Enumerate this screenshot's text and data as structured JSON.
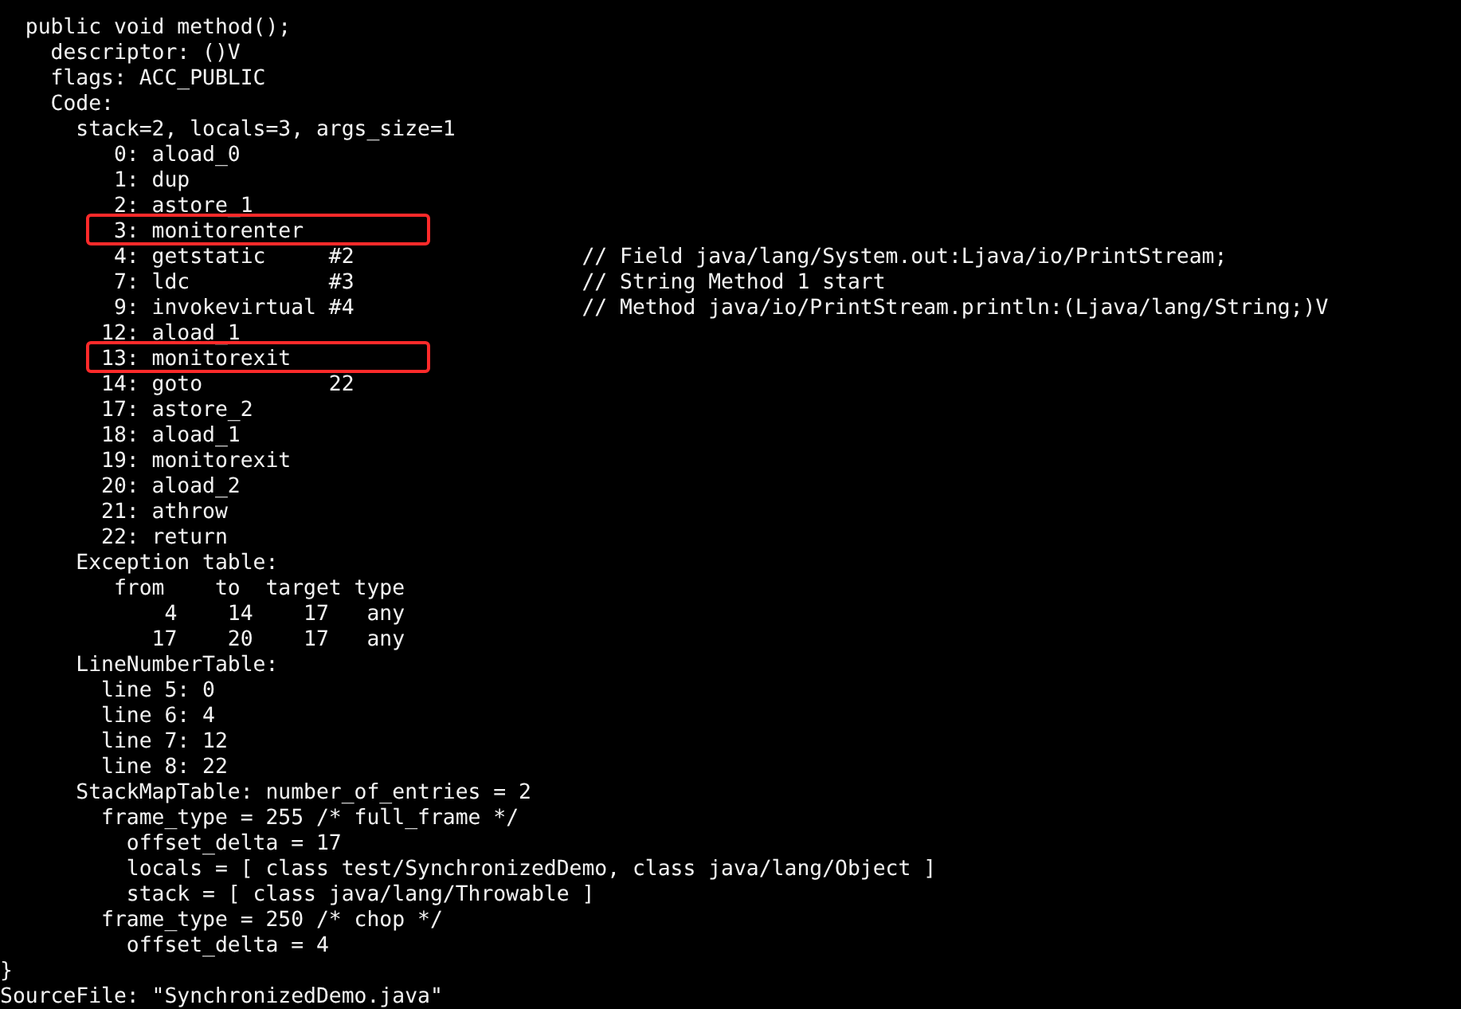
{
  "console": {
    "lines": [
      {
        "text": "  public void method();",
        "highlighted": false
      },
      {
        "text": "    descriptor: ()V",
        "highlighted": false
      },
      {
        "text": "    flags: ACC_PUBLIC",
        "highlighted": false
      },
      {
        "text": "    Code:",
        "highlighted": false
      },
      {
        "text": "      stack=2, locals=3, args_size=1",
        "highlighted": false
      },
      {
        "text": "         0: aload_0",
        "highlighted": false
      },
      {
        "text": "         1: dup",
        "highlighted": false
      },
      {
        "text": "         2: astore_1",
        "highlighted": false
      },
      {
        "text": "         3: monitorenter",
        "highlighted": true
      },
      {
        "text": "         4: getstatic     #2                  // Field java/lang/System.out:Ljava/io/PrintStream;",
        "highlighted": false
      },
      {
        "text": "         7: ldc           #3                  // String Method 1 start",
        "highlighted": false
      },
      {
        "text": "         9: invokevirtual #4                  // Method java/io/PrintStream.println:(Ljava/lang/String;)V",
        "highlighted": false
      },
      {
        "text": "        12: aload_1",
        "highlighted": false
      },
      {
        "text": "        13: monitorexit",
        "highlighted": true
      },
      {
        "text": "        14: goto          22",
        "highlighted": false
      },
      {
        "text": "        17: astore_2",
        "highlighted": false
      },
      {
        "text": "        18: aload_1",
        "highlighted": false
      },
      {
        "text": "        19: monitorexit",
        "highlighted": false
      },
      {
        "text": "        20: aload_2",
        "highlighted": false
      },
      {
        "text": "        21: athrow",
        "highlighted": false
      },
      {
        "text": "        22: return",
        "highlighted": false
      },
      {
        "text": "      Exception table:",
        "highlighted": false
      },
      {
        "text": "         from    to  target type",
        "highlighted": false
      },
      {
        "text": "             4    14    17   any",
        "highlighted": false
      },
      {
        "text": "            17    20    17   any",
        "highlighted": false
      },
      {
        "text": "      LineNumberTable:",
        "highlighted": false
      },
      {
        "text": "        line 5: 0",
        "highlighted": false
      },
      {
        "text": "        line 6: 4",
        "highlighted": false
      },
      {
        "text": "        line 7: 12",
        "highlighted": false
      },
      {
        "text": "        line 8: 22",
        "highlighted": false
      },
      {
        "text": "      StackMapTable: number_of_entries = 2",
        "highlighted": false
      },
      {
        "text": "        frame_type = 255 /* full_frame */",
        "highlighted": false
      },
      {
        "text": "          offset_delta = 17",
        "highlighted": false
      },
      {
        "text": "          locals = [ class test/SynchronizedDemo, class java/lang/Object ]",
        "highlighted": false
      },
      {
        "text": "          stack = [ class java/lang/Throwable ]",
        "highlighted": false
      },
      {
        "text": "        frame_type = 250 /* chop */",
        "highlighted": false
      },
      {
        "text": "          offset_delta = 4",
        "highlighted": false
      },
      {
        "text": "}",
        "highlighted": false
      },
      {
        "text": "SourceFile: \"SynchronizedDemo.java\"",
        "highlighted": false
      }
    ]
  }
}
